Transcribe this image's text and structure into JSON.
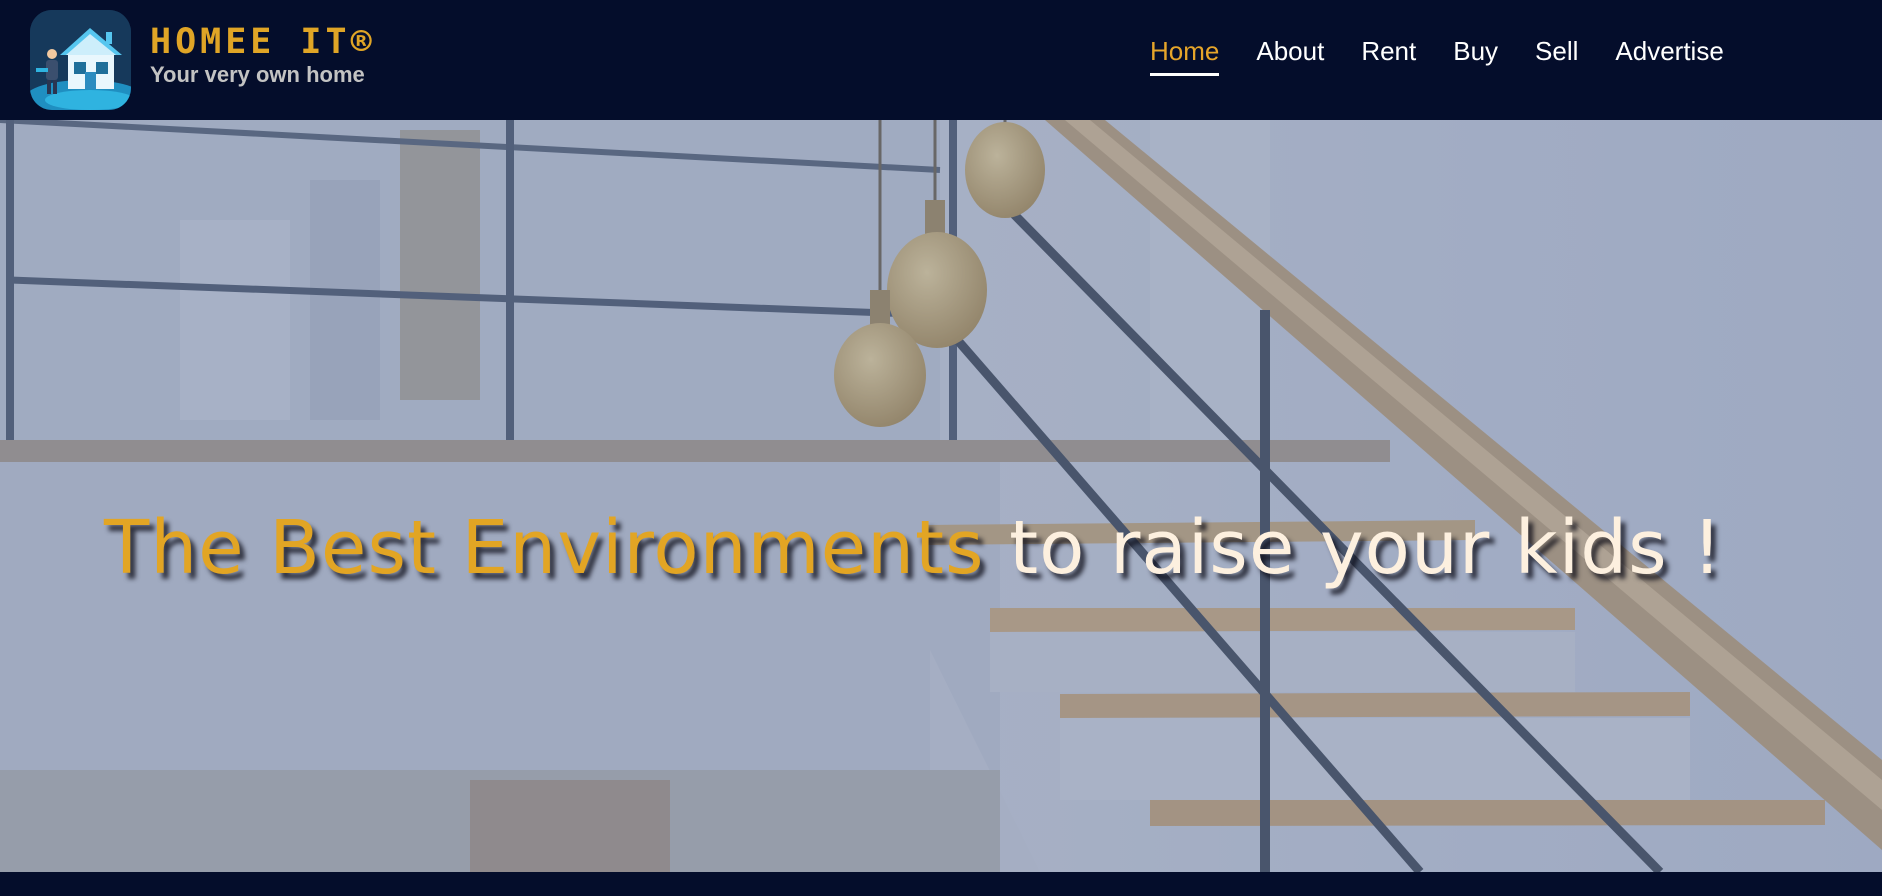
{
  "brand": {
    "name": "HOMEE IT®",
    "tagline": "Your very own home",
    "logo_icon": "house-logo-icon"
  },
  "nav": {
    "items": [
      {
        "label": "Home",
        "active": true
      },
      {
        "label": "About",
        "active": false
      },
      {
        "label": "Rent",
        "active": false
      },
      {
        "label": "Buy",
        "active": false
      },
      {
        "label": "Sell",
        "active": false
      },
      {
        "label": "Advertise",
        "active": false
      }
    ]
  },
  "hero": {
    "headline_accent": "The Best Environments",
    "headline_rest": " to raise your kids !"
  },
  "colors": {
    "header_bg": "#040d2b",
    "accent": "#e2a524",
    "nav_text": "#ffffff",
    "tagline": "#c3c3c3"
  }
}
